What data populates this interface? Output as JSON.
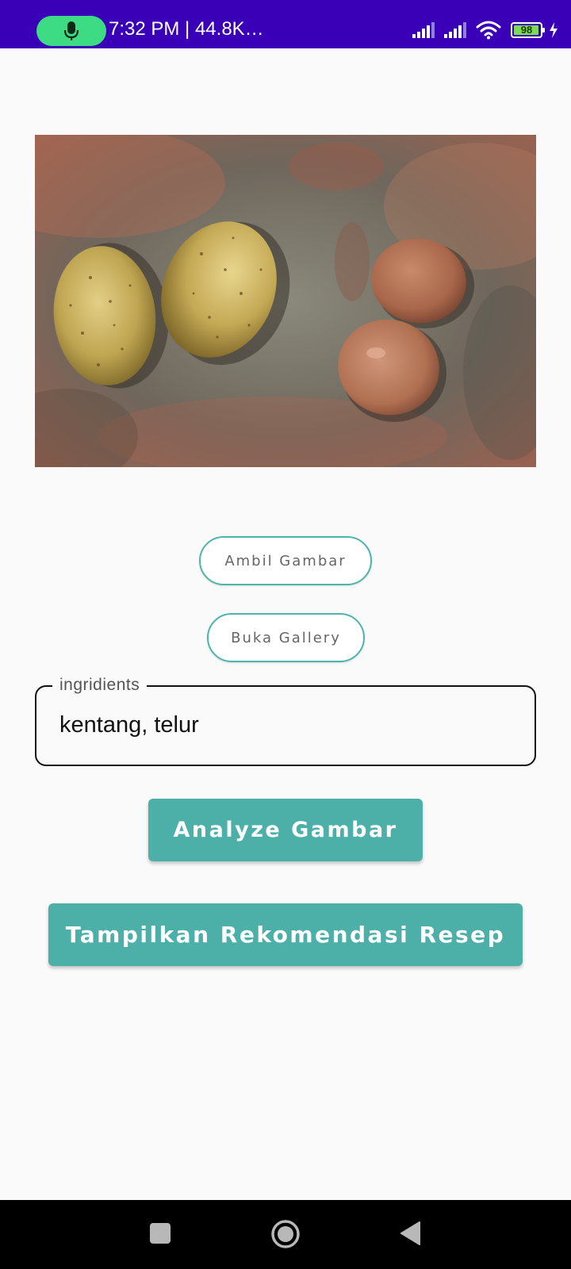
{
  "status_bar": {
    "text": "7:32 PM | 44.8K…",
    "battery": "98",
    "battery_level": 0.98,
    "icons": [
      "mic-icon",
      "signal-icon",
      "signal-icon",
      "wifi-icon",
      "battery-icon",
      "charging-icon"
    ]
  },
  "photo": {
    "subject": "two potatoes and two eggs on a cloth",
    "icon": "photo-image"
  },
  "buttons": {
    "take_picture": "Ambil Gambar",
    "open_gallery": "Buka Gallery",
    "analyze": "Analyze Gambar",
    "recommend": "Tampilkan Rekomendasi Resep"
  },
  "ingredients_field": {
    "label": "ingridients",
    "value": "kentang, telur"
  },
  "nav": {
    "icons": [
      "recents-icon",
      "home-icon",
      "back-icon"
    ]
  },
  "colors": {
    "status_bar": "#3a00b7",
    "accent": "#4db0a8",
    "mic_pill": "#3ddc84",
    "background": "#fafafa"
  }
}
